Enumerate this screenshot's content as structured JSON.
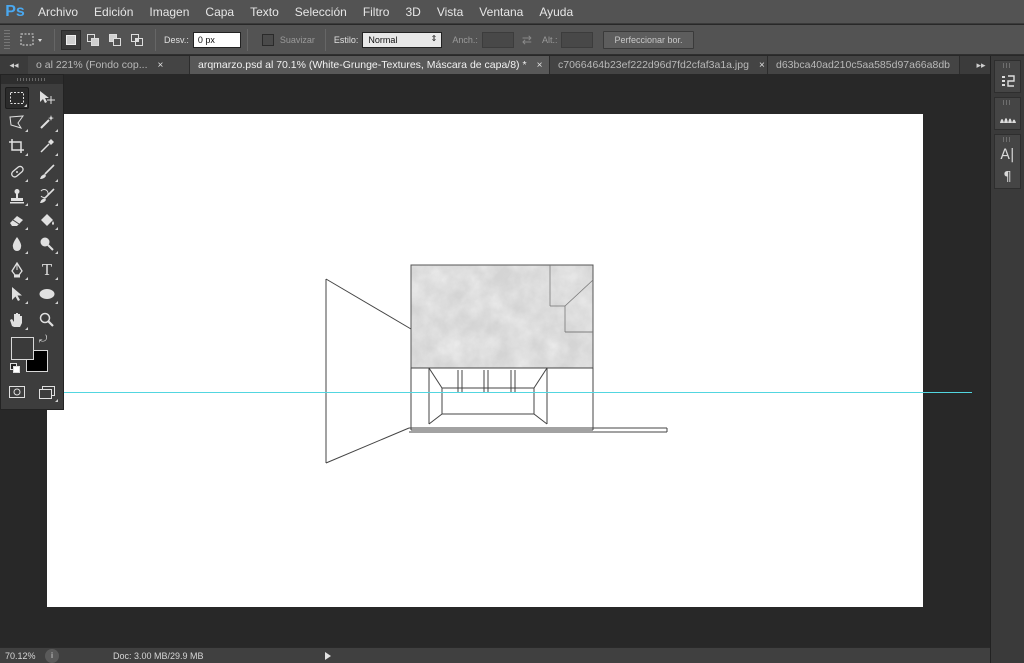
{
  "app": {
    "logo": "Ps"
  },
  "menu": [
    "Archivo",
    "Edición",
    "Imagen",
    "Capa",
    "Texto",
    "Selección",
    "Filtro",
    "3D",
    "Vista",
    "Ventana",
    "Ayuda"
  ],
  "options": {
    "feather_label": "Desv.:",
    "feather_value": "0 px",
    "antialias_label": "Suavizar",
    "style_label": "Estilo:",
    "style_value": "Normal",
    "width_label": "Anch.:",
    "height_label": "Alt.:",
    "refine_label": "Perfeccionar bor."
  },
  "tabs": [
    {
      "label": "o al 221% (Fondo cop...",
      "close": "×",
      "active": false
    },
    {
      "label": "arqmarzo.psd al 70.1% (White-Grunge-Textures, Máscara de capa/8) *",
      "close": "×",
      "active": true
    },
    {
      "label": "c7066464b23ef222d96d7fd2cfaf3a1a.jpg",
      "close": "×",
      "active": false
    },
    {
      "label": "d63bca40ad210c5aa585d97a66a8db",
      "close": "",
      "active": false
    }
  ],
  "status": {
    "zoom": "70.12%",
    "doc_info": "Doc: 3.00 MB/29.9 MB"
  },
  "colors": {
    "foreground": "#3a3a3a",
    "background": "#000000",
    "guide": "#52d6e0",
    "logo": "#4aa8f0"
  },
  "tools": [
    "rectangular-marquee-tool",
    "move-tool",
    "polygonal-lasso-tool",
    "magic-wand-tool",
    "crop-tool",
    "eyedropper-tool",
    "spot-healing-tool",
    "brush-tool",
    "clone-stamp-tool",
    "history-brush-tool",
    "eraser-tool",
    "paint-bucket-tool",
    "blur-tool",
    "dodge-tool",
    "pen-tool",
    "type-tool",
    "path-selection-tool",
    "ellipse-tool",
    "hand-tool",
    "zoom-tool"
  ]
}
